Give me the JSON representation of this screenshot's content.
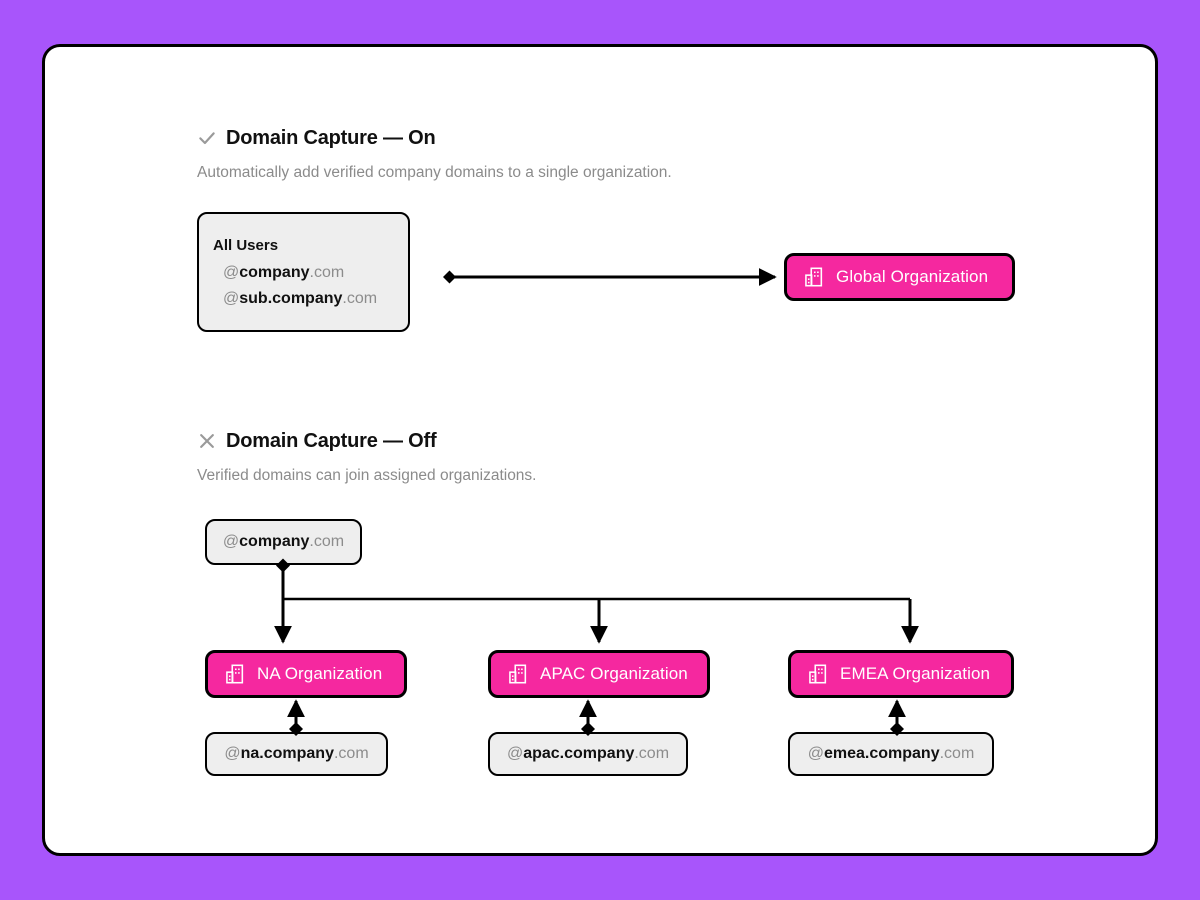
{
  "page": {
    "background_color": "#a855fb",
    "card_color": "#ffffff",
    "accent_color": "#f5289f",
    "border_color": "#000000"
  },
  "sections": [
    {
      "id": "on",
      "icon": "check-icon",
      "title": "Domain Capture — On",
      "subtitle": "Automatically add verified company domains to a single organization.",
      "source": {
        "heading": "All Users",
        "domains": [
          {
            "at": "@",
            "name": "company",
            "tld": ".com"
          },
          {
            "at": "@",
            "name": "sub.company",
            "tld": ".com"
          }
        ]
      },
      "target": {
        "icon": "organization-icon",
        "label": "Global Organization"
      }
    },
    {
      "id": "off",
      "icon": "x-icon",
      "title": "Domain Capture — Off",
      "subtitle": "Verified domains can join assigned organizations.",
      "root": {
        "at": "@",
        "name": "company",
        "tld": ".com"
      },
      "branches": [
        {
          "org": {
            "icon": "organization-icon",
            "label": "NA Organization"
          },
          "domain": {
            "at": "@",
            "name": "na.company",
            "tld": ".com"
          }
        },
        {
          "org": {
            "icon": "organization-icon",
            "label": "APAC Organization"
          },
          "domain": {
            "at": "@",
            "name": "apac.company",
            "tld": ".com"
          }
        },
        {
          "org": {
            "icon": "organization-icon",
            "label": "EMEA Organization"
          },
          "domain": {
            "at": "@",
            "name": "emea.company",
            "tld": ".com"
          }
        }
      ]
    }
  ]
}
